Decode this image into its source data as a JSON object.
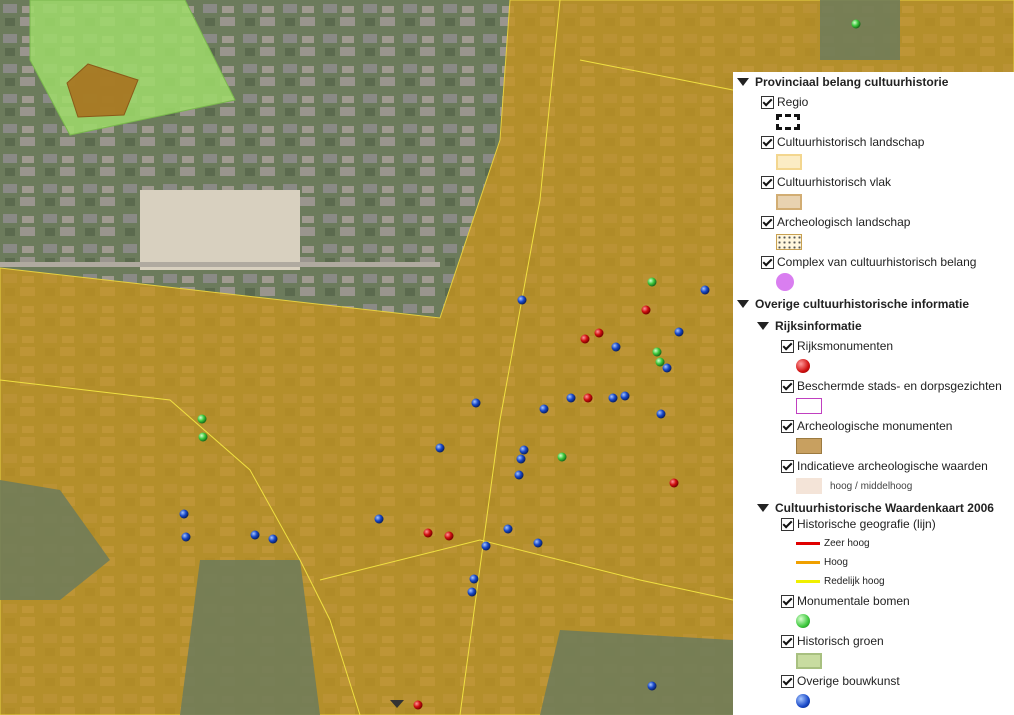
{
  "legend": {
    "group1": {
      "title": "Provinciaal belang cultuurhistorie",
      "items": [
        {
          "label": "Regio"
        },
        {
          "label": "Cultuurhistorisch landschap"
        },
        {
          "label": "Cultuurhistorisch vlak"
        },
        {
          "label": "Archeologisch landschap"
        },
        {
          "label": "Complex van cultuurhistorisch belang"
        }
      ]
    },
    "group2": {
      "title": "Overige cultuurhistorische informatie",
      "sub1": {
        "title": "Rijksinformatie",
        "items": [
          {
            "label": "Rijksmonumenten"
          },
          {
            "label": "Beschermde stads- en dorpsgezichten"
          },
          {
            "label": "Archeologische monumenten"
          },
          {
            "label": "Indicatieve archeologische waarden",
            "sublabel": "hoog / middelhoog"
          }
        ]
      },
      "sub2": {
        "title": "Cultuurhistorische Waardenkaart 2006",
        "items": [
          {
            "label": "Historische geografie (lijn)"
          },
          {
            "label": "Monumentale bomen"
          },
          {
            "label": "Historisch groen"
          },
          {
            "label": "Overige bouwkunst"
          }
        ],
        "lines": [
          {
            "label": "Zeer hoog",
            "color": "#e00000"
          },
          {
            "label": "Hoog",
            "color": "#f0a000"
          },
          {
            "label": "Redelijk hoog",
            "color": "#f0f000"
          }
        ]
      }
    }
  },
  "colors": {
    "overlay": "#c8951e",
    "region_green": "#9fdc6a",
    "complex": "#d97ef0",
    "red_marker": "#d01010",
    "blue_marker": "#1848c8",
    "green_marker": "#3cc83c"
  },
  "markers": {
    "blue": [
      [
        522,
        300
      ],
      [
        616,
        347
      ],
      [
        679,
        332
      ],
      [
        705,
        290
      ],
      [
        667,
        368
      ],
      [
        476,
        403
      ],
      [
        544,
        409
      ],
      [
        571,
        398
      ],
      [
        613,
        398
      ],
      [
        625,
        396
      ],
      [
        661,
        414
      ],
      [
        440,
        448
      ],
      [
        524,
        450
      ],
      [
        521,
        459
      ],
      [
        519,
        475
      ],
      [
        184,
        514
      ],
      [
        186,
        537
      ],
      [
        255,
        535
      ],
      [
        273,
        539
      ],
      [
        379,
        519
      ],
      [
        508,
        529
      ],
      [
        486,
        546
      ],
      [
        538,
        543
      ],
      [
        474,
        579
      ],
      [
        472,
        592
      ],
      [
        652,
        686
      ]
    ],
    "red": [
      [
        585,
        339
      ],
      [
        599,
        333
      ],
      [
        646,
        310
      ],
      [
        588,
        398
      ],
      [
        674,
        483
      ],
      [
        428,
        533
      ],
      [
        449,
        536
      ],
      [
        418,
        705
      ]
    ],
    "green": [
      [
        652,
        282
      ],
      [
        657,
        352
      ],
      [
        660,
        362
      ],
      [
        202,
        419
      ],
      [
        203,
        437
      ],
      [
        562,
        457
      ],
      [
        856,
        24
      ]
    ]
  }
}
